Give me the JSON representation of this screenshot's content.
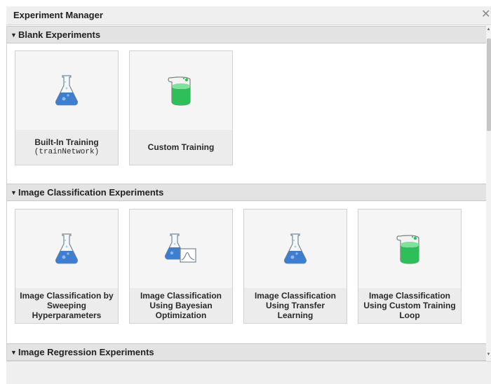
{
  "window": {
    "title": "Experiment Manager",
    "close_glyph": "✕"
  },
  "sections": [
    {
      "label": "Blank Experiments",
      "arrow": "▼",
      "cards": [
        {
          "line1": "Built-In Training",
          "line2": "(trainNetwork)",
          "icon": "flask-icon"
        },
        {
          "line1": "Custom Training",
          "icon": "beaker-icon"
        }
      ]
    },
    {
      "label": "Image Classification Experiments",
      "arrow": "▼",
      "cards": [
        {
          "line1": "Image Classification by Sweeping Hyperparameters",
          "icon": "flask-icon"
        },
        {
          "line1": "Image Classification Using Bayesian Optimization",
          "icon": "flask-chart-icon"
        },
        {
          "line1": "Image Classification Using Transfer Learning",
          "icon": "flask-icon"
        },
        {
          "line1": "Image Classification Using Custom Training Loop",
          "icon": "beaker-icon"
        }
      ]
    },
    {
      "label": "Image Regression Experiments",
      "arrow": "▼"
    }
  ],
  "scrollbar": {
    "up_glyph": "▲",
    "down_glyph": "▼"
  },
  "colors": {
    "flask_liquid": "#3d7ed1",
    "beaker_liquid": "#2fbf5a",
    "section_header_bg": "#e3e3e3",
    "card_bg": "#f5f5f5"
  }
}
